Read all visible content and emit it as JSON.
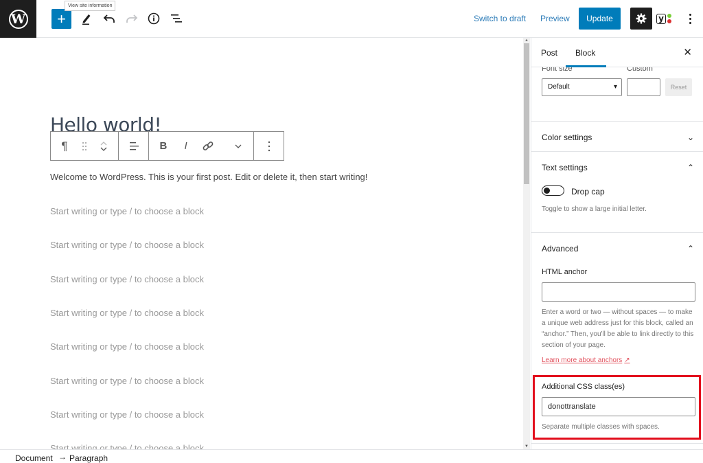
{
  "topbar": {
    "tooltip": "View site information",
    "add_block_label": "+",
    "switch_to_draft": "Switch to draft",
    "preview": "Preview",
    "update": "Update",
    "icons": [
      "wordpress-logo",
      "add-block",
      "tools-pencil",
      "undo",
      "redo",
      "info",
      "list-view",
      "settings-gear",
      "yoast-seo",
      "more-options"
    ],
    "yoast_dot_colors": [
      "#7ad03a",
      "#dc3232"
    ]
  },
  "editor": {
    "title": "Hello world!",
    "welcome_text": "Welcome to WordPress. This is your first post. Edit or delete it, then start writing!",
    "placeholder": "Start writing or type / to choose a block",
    "placeholder_count": 8,
    "block_toolbar": {
      "paragraph": "¶",
      "bold": "B",
      "italic": "I"
    }
  },
  "sidebar": {
    "tabs": [
      {
        "label": "Post",
        "active": false
      },
      {
        "label": "Block",
        "active": true
      }
    ],
    "close": "✕",
    "typography": {
      "font_size_label": "Font size",
      "custom_label": "Custom",
      "font_size_value": "Default",
      "custom_value": "",
      "reset": "Reset"
    },
    "color_settings": {
      "title": "Color settings",
      "expanded": false
    },
    "text_settings": {
      "title": "Text settings",
      "expanded": true,
      "drop_cap_label": "Drop cap",
      "drop_cap_on": false,
      "drop_cap_help": "Toggle to show a large initial letter."
    },
    "advanced": {
      "title": "Advanced",
      "expanded": true,
      "html_anchor_label": "HTML anchor",
      "html_anchor_value": "",
      "html_anchor_help": "Enter a word or two — without spaces — to make a unique web address just for this block, called an “anchor.” Then, you'll be able to link directly to this section of your page.",
      "learn_more": "Learn more about anchors",
      "css_class_label": "Additional CSS class(es)",
      "css_class_value": "donottranslate",
      "css_class_help": "Separate multiple classes with spaces."
    },
    "highlight_color": "#e20d1c"
  },
  "footer": {
    "breadcrumbs": [
      "Document",
      "Paragraph"
    ],
    "separator": "→"
  },
  "colors": {
    "accent": "#007cba",
    "dark": "#1e1e1e"
  }
}
